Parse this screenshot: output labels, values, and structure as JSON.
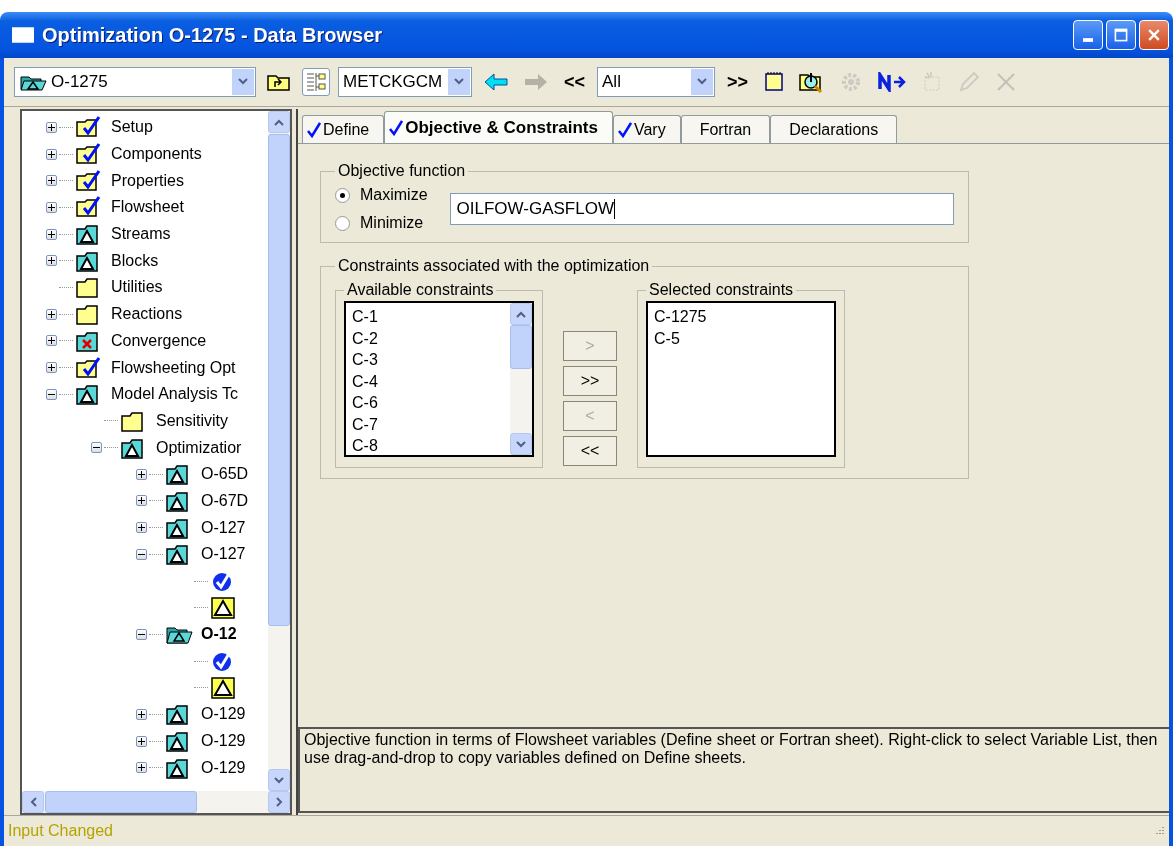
{
  "window": {
    "title": "Optimization O-1275 - Data Browser"
  },
  "toolbar": {
    "object_combo": {
      "value": "O-1275"
    },
    "units_combo": {
      "value": "METCKGCM"
    },
    "filter_combo": {
      "value": "All"
    },
    "prev_label": "<<",
    "next_label": ">>",
    "tools": [
      {
        "kind": "folder-up"
      },
      {
        "kind": "tree-toggle",
        "selected": true
      }
    ],
    "nav": [
      {
        "kind": "back",
        "disabled": false
      },
      {
        "kind": "forward",
        "disabled": true
      }
    ],
    "actions": [
      {
        "kind": "note"
      },
      {
        "kind": "status"
      },
      {
        "kind": "gear",
        "disabled": true
      },
      {
        "kind": "next"
      },
      {
        "kind": "new-sheet",
        "disabled": true
      },
      {
        "kind": "pencil",
        "disabled": true
      },
      {
        "kind": "delete",
        "disabled": true
      }
    ]
  },
  "tree": [
    {
      "label": "Setup",
      "kind": "complete",
      "expanded": false
    },
    {
      "label": "Components",
      "kind": "complete",
      "expanded": false
    },
    {
      "label": "Properties",
      "kind": "complete",
      "expanded": false
    },
    {
      "label": "Flowsheet",
      "kind": "complete",
      "expanded": false
    },
    {
      "label": "Streams",
      "kind": "incomplete",
      "expanded": false
    },
    {
      "label": "Blocks",
      "kind": "incomplete",
      "expanded": false
    },
    {
      "label": "Utilities",
      "kind": "empty"
    },
    {
      "label": "Reactions",
      "kind": "empty",
      "expanded": false
    },
    {
      "label": "Convergence",
      "kind": "error",
      "expanded": false
    },
    {
      "label": "Flowsheeting Opt",
      "kind": "complete",
      "expanded": false
    },
    {
      "label": "Model Analysis Tc",
      "kind": "incomplete",
      "expanded": true,
      "children": [
        {
          "label": "Sensitivity",
          "kind": "empty"
        },
        {
          "label": "Optimizatior",
          "kind": "incomplete",
          "expanded": true,
          "children": [
            {
              "label": "O-65D",
              "kind": "incomplete",
              "expanded": false
            },
            {
              "label": "O-67D",
              "kind": "incomplete",
              "expanded": false
            },
            {
              "label": "O-127",
              "kind": "incomplete",
              "expanded": false
            },
            {
              "label": "O-127",
              "kind": "incomplete",
              "expanded": true,
              "children": [
                {
                  "kind": "sheet-complete"
                },
                {
                  "kind": "sheet-incomplete"
                }
              ]
            },
            {
              "label": "O-12",
              "kind": "current",
              "expanded": true,
              "selected": true,
              "children": [
                {
                  "kind": "sheet-complete"
                },
                {
                  "kind": "sheet-incomplete"
                }
              ]
            },
            {
              "label": "O-129",
              "kind": "incomplete",
              "expanded": false
            },
            {
              "label": "O-129",
              "kind": "incomplete",
              "expanded": false
            },
            {
              "label": "O-129",
              "kind": "incomplete",
              "expanded": false
            }
          ]
        }
      ]
    }
  ],
  "tabs": [
    {
      "label": "Define",
      "checked": true,
      "selected": false
    },
    {
      "label": "Objective & Constraints",
      "checked": true,
      "selected": true
    },
    {
      "label": "Vary",
      "checked": true,
      "selected": false
    },
    {
      "label": "Fortran",
      "checked": false,
      "selected": false
    },
    {
      "label": "Declarations",
      "checked": false,
      "selected": false
    }
  ],
  "objective": {
    "title": "Objective function",
    "options": [
      {
        "label": "Maximize",
        "selected": true
      },
      {
        "label": "Minimize",
        "selected": false
      }
    ],
    "expression": "OILFOW-GASFLOW"
  },
  "constraints": {
    "title": "Constraints associated with the optimization",
    "available": {
      "title": "Available constraints",
      "items": [
        "C-1",
        "C-2",
        "C-3",
        "C-4",
        "C-6",
        "C-7",
        "C-8"
      ]
    },
    "buttons": [
      {
        "label": ">",
        "disabled": true
      },
      {
        "label": ">>",
        "disabled": false
      },
      {
        "label": "<",
        "disabled": true
      },
      {
        "label": "<<",
        "disabled": false
      }
    ],
    "selected": {
      "title": "Selected constraints",
      "items": [
        "C-1275",
        "C-5"
      ]
    }
  },
  "description": "Objective function in terms of Flowsheet variables (Define sheet or Fortran sheet). Right-click to select Variable List, then use drag-and-drop to copy variables defined on Define sheets.",
  "status_bar": {
    "message": "Input Changed"
  }
}
